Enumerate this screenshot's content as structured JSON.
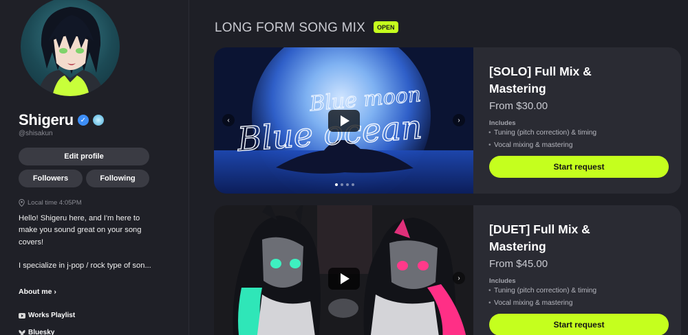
{
  "profile": {
    "name": "Shigeru",
    "handle": "@shisakun",
    "edit_label": "Edit profile",
    "followers_label": "Followers",
    "following_label": "Following",
    "local_time": "Local time 4:05PM",
    "bio": "Hello! Shigeru here, and I'm here to make you sound great on your song covers!\n\nI specialize in j-pop / rock type of son...",
    "about_label": "About me",
    "links": [
      {
        "label": "Works Playlist",
        "icon": "youtube-icon"
      },
      {
        "label": "Bluesky",
        "icon": "bluesky-icon"
      }
    ]
  },
  "section": {
    "title": "LONG FORM SONG MIX",
    "badge": "OPEN"
  },
  "cards": [
    {
      "title": "[SOLO] Full Mix & Mastering",
      "price": "From $30.00",
      "includes_label": "Includes",
      "includes": [
        "Tuning (pitch correction) & timing",
        "Vocal mixing & mastering"
      ],
      "cta": "Start request",
      "thumbnail_text_1": "Blue moon",
      "thumbnail_text_2": "Blue ocean",
      "carousel_count": 4,
      "carousel_active": 1
    },
    {
      "title": "[DUET] Full Mix & Mastering",
      "price": "From $45.00",
      "includes_label": "Includes",
      "includes": [
        "Tuning (pitch correction) & timing",
        "Vocal mixing & mastering"
      ],
      "cta": "Start request"
    }
  ],
  "colors": {
    "accent": "#c5ff1e",
    "background": "#1e1f26",
    "card": "#2a2b33"
  }
}
